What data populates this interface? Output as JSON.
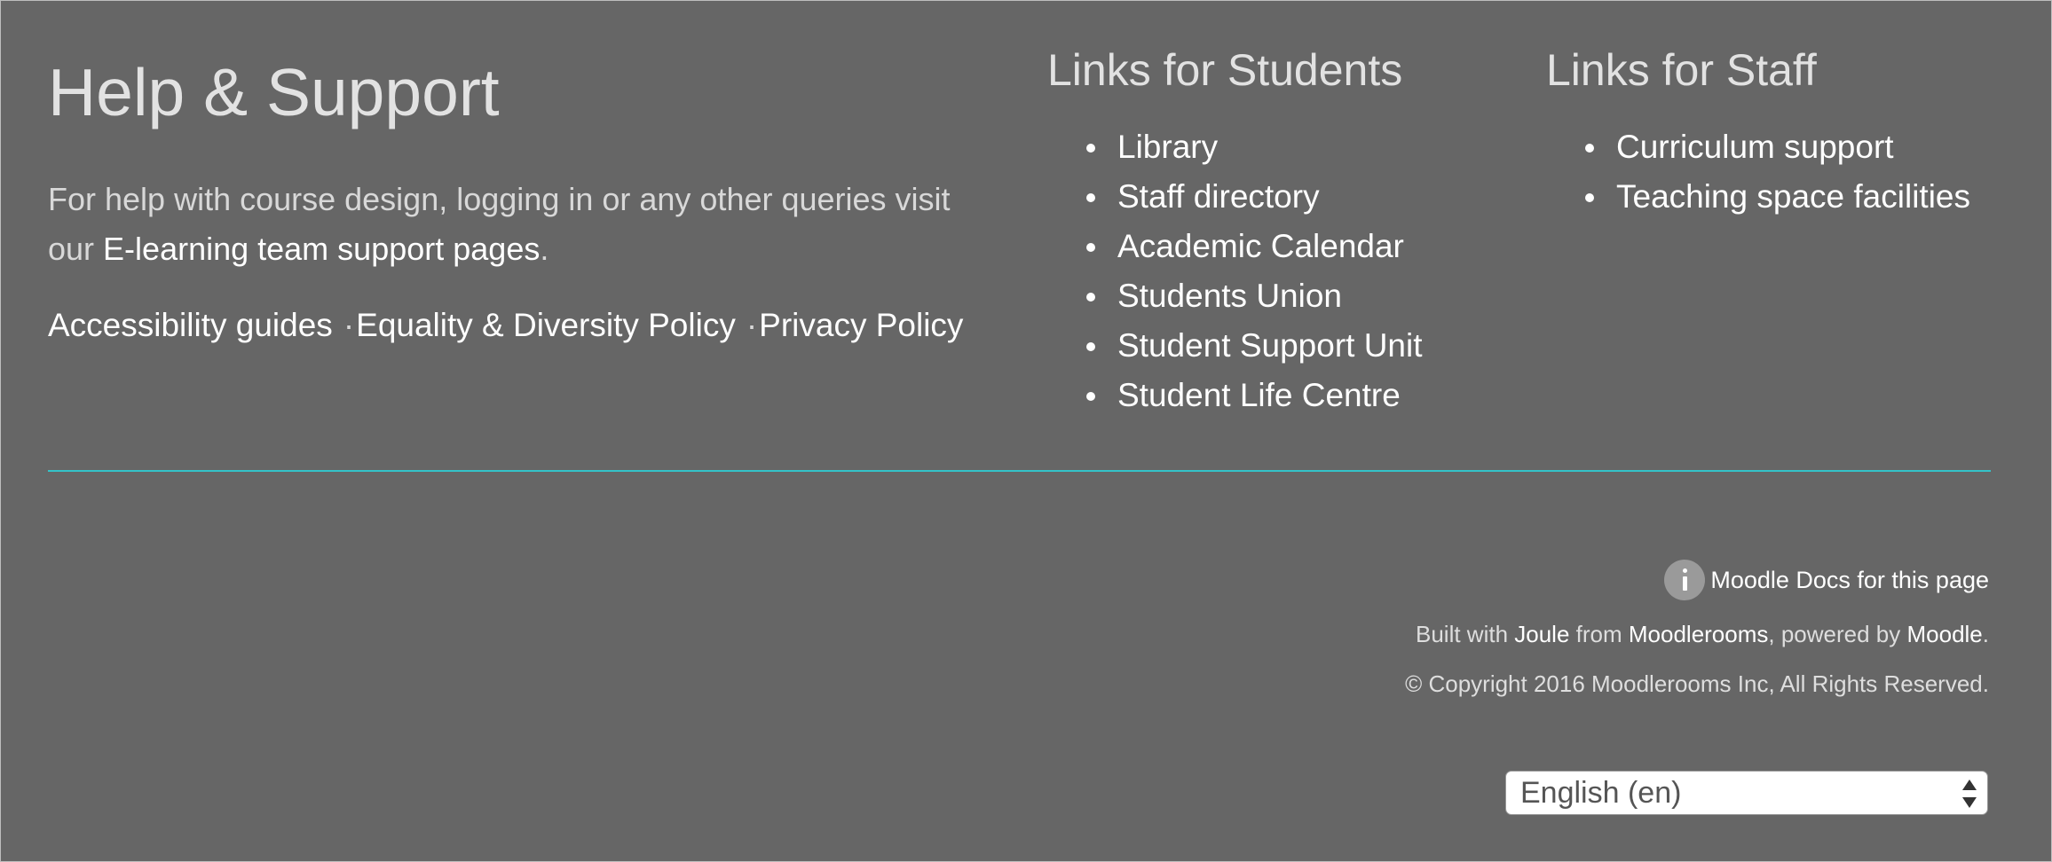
{
  "help": {
    "title": "Help & Support",
    "text_before": "For help with course design, logging in or any other queries visit our ",
    "link_text": "E-learning team support pages",
    "text_after": ".",
    "policy_links": [
      "Accessibility guides",
      "Equality & Diversity Policy",
      "Privacy Policy"
    ],
    "separator": "·"
  },
  "students": {
    "heading": "Links for Students",
    "items": [
      "Library",
      "Staff directory",
      "Academic Calendar",
      "Students Union",
      "Student Support Unit",
      "Student Life Centre"
    ]
  },
  "staff": {
    "heading": "Links for Staff",
    "items": [
      "Curriculum support",
      "Teaching space facilities"
    ]
  },
  "footer": {
    "docs_link": "Moodle Docs for this page",
    "built_prefix": "Built with ",
    "built_joule": "Joule",
    "built_from": " from ",
    "built_moodlerooms": "Moodlerooms",
    "built_powered": ", powered by ",
    "built_moodle": "Moodle",
    "built_suffix": ".",
    "copyright": "© Copyright 2016 Moodlerooms Inc, All Rights Reserved."
  },
  "language": {
    "selected": "English (en)"
  },
  "colors": {
    "background": "#666666",
    "divider": "#34c3c9",
    "link": "#ffffff"
  },
  "icons": {
    "docs": "info-icon",
    "select": "select-arrows-icon"
  }
}
